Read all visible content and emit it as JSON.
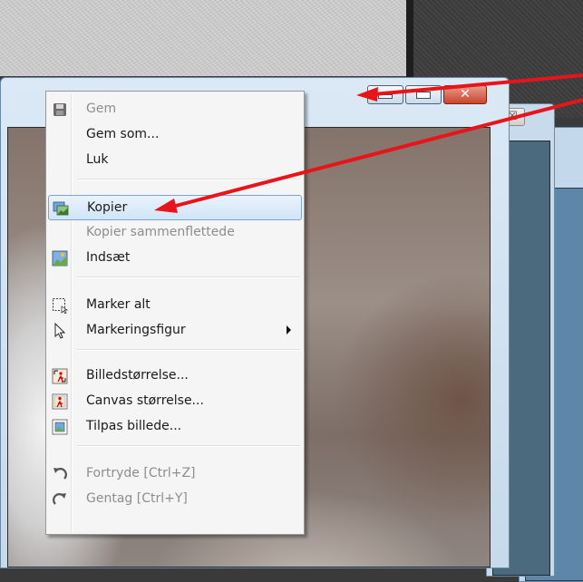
{
  "window": {
    "close_glyph": "✕",
    "back_close_glyph": "☒"
  },
  "menu": {
    "items": [
      {
        "label": "Gem",
        "icon": "save-icon",
        "disabled": true
      },
      {
        "label": "Gem som...",
        "icon": "",
        "disabled": false
      },
      {
        "label": "Luk",
        "icon": "",
        "disabled": false
      },
      {
        "label": "Kopier",
        "icon": "copy-image-icon",
        "disabled": false,
        "highlighted": true
      },
      {
        "label": "Kopier sammenflettede",
        "icon": "",
        "disabled": true
      },
      {
        "label": "Indsæt",
        "icon": "paste-image-icon",
        "disabled": false
      },
      {
        "label": "Marker alt",
        "icon": "select-all-icon",
        "disabled": false
      },
      {
        "label": "Markeringsfigur",
        "icon": "pointer-icon",
        "disabled": false,
        "submenu": true
      },
      {
        "label": "Billedstørrelse...",
        "icon": "image-size-icon",
        "disabled": false
      },
      {
        "label": "Canvas størrelse...",
        "icon": "canvas-size-icon",
        "disabled": false
      },
      {
        "label": "Tilpas billede...",
        "icon": "fit-image-icon",
        "disabled": false
      },
      {
        "label": "Fortryde [Ctrl+Z]",
        "icon": "undo-icon",
        "disabled": true
      },
      {
        "label": "Gentag [Ctrl+Y]",
        "icon": "redo-icon",
        "disabled": true
      }
    ]
  },
  "colors": {
    "annotation_arrow": "#e8141a",
    "highlight_border": "#7da2ce",
    "disabled_text": "#8d8d8d"
  }
}
